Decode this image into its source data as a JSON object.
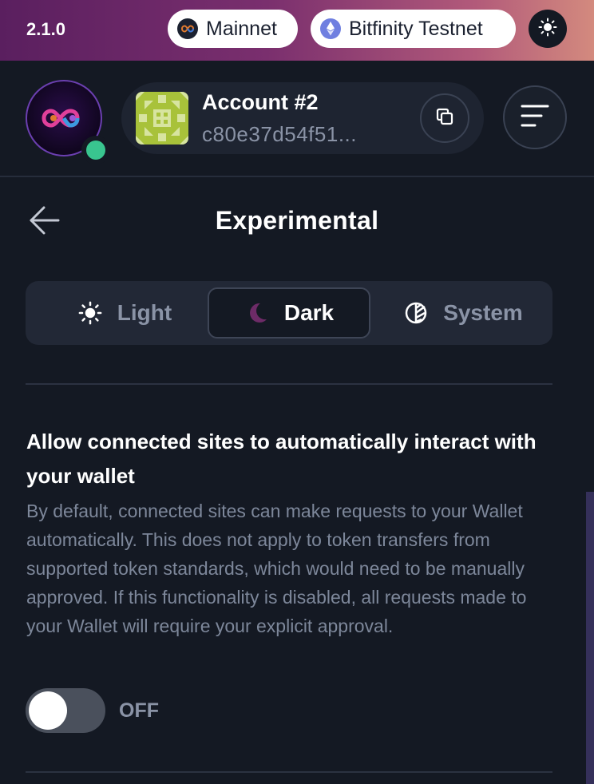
{
  "topbar": {
    "version": "2.1.0",
    "networks": [
      {
        "label": "Mainnet",
        "icon": "infinity-logo-icon",
        "color": "#1b2130"
      },
      {
        "label": "Bitfinity Testnet",
        "icon": "ethereum-icon",
        "color": "#6f7fe0"
      }
    ],
    "theme_toggle_icon": "sun-icon"
  },
  "header": {
    "account_name": "Account #2",
    "account_address": "c80e37d54f51...",
    "status_color": "#39c58f"
  },
  "page": {
    "title": "Experimental"
  },
  "theme_selector": {
    "options": [
      {
        "label": "Light",
        "icon": "sun-icon",
        "selected": false
      },
      {
        "label": "Dark",
        "icon": "moon-icon",
        "selected": true
      },
      {
        "label": "System",
        "icon": "half-circle-icon",
        "selected": false
      }
    ],
    "accent_color": "#6d2b67"
  },
  "setting": {
    "title": "Allow connected sites to automatically interact with your wallet",
    "description": "By default, connected sites can make requests to your Wallet automatically. This does not apply to token transfers from supported token standards, which would need to be manually approved. If this functionality is disabled, all requests made to your Wallet will require your explicit approval.",
    "toggle_state": "OFF"
  }
}
